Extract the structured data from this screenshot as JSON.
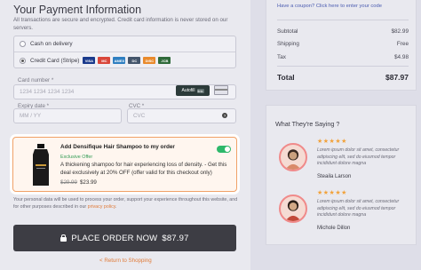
{
  "payment": {
    "title": "Your Payment Information",
    "note": "All transactions are secure and encrypted. Credit card information is never stored on our servers.",
    "options": [
      {
        "label": "Cash on delivery",
        "selected": false
      },
      {
        "label": "Credit Card (Stripe)",
        "selected": true
      }
    ],
    "card_brands": [
      "VISA",
      "MC",
      "AMEX",
      "DC",
      "DISC",
      "JCB"
    ],
    "card_number_label": "Card number *",
    "card_number_placeholder": "1234 1234 1234 1234",
    "autofill_label": "Autofill",
    "autofill_badge": "link",
    "expiry_label": "Expiry date *",
    "expiry_placeholder": "MM / YY",
    "cvc_label": "CVC *",
    "cvc_placeholder": "CVC",
    "help_icon": "?"
  },
  "offer": {
    "title": "Add Densifique Hair Shampoo to my order",
    "tag": "Exclusive Offer",
    "description": "A thickening shampoo for hair experiencing loss of density. - Get this deal exclusively at 20% OFF (offer valid for this checkout only)",
    "old_price": "$29.99",
    "new_price": "$23.99",
    "toggle_on": true,
    "icon": "shampoo-bottle-icon"
  },
  "privacy": {
    "text": "Your personal data will be used to process your order, support your experience throughout this website, and for other purposes described in our ",
    "link": "privacy policy",
    "end": "."
  },
  "place_order": {
    "label": "PLACE ORDER NOW",
    "amount": "$87.97"
  },
  "return_link": "< Return to Shopping",
  "summary": {
    "coupon_text": "Have a coupon? Click here to enter your code",
    "rows": [
      {
        "label": "Subtotal",
        "value": "$82.99"
      },
      {
        "label": "Shipping",
        "value": "Free"
      },
      {
        "label": "Tax",
        "value": "$4.98"
      }
    ],
    "total_label": "Total",
    "total_value": "$87.97"
  },
  "reviews": {
    "title": "What They're Saying ?",
    "items": [
      {
        "stars": "★★★★★",
        "rating": 5,
        "text": "Lorem ipsum dolor sit amet, consectetur adipiscing elit, sed do eiusmod tempor incididunt dolore magna",
        "name": "Steaila Larson"
      },
      {
        "stars": "★★★★★",
        "rating": 5,
        "text": "Lorem ipsum dolor sit amet, consectetur adipiscing elit, sed do eiusmod tempor incididunt dolore magna",
        "name": "Michole Dillon"
      }
    ]
  },
  "colors": {
    "accent": "#e07b39",
    "toggle": "#2eb86a",
    "star": "#f2a23a",
    "button": "#3d3d44"
  }
}
